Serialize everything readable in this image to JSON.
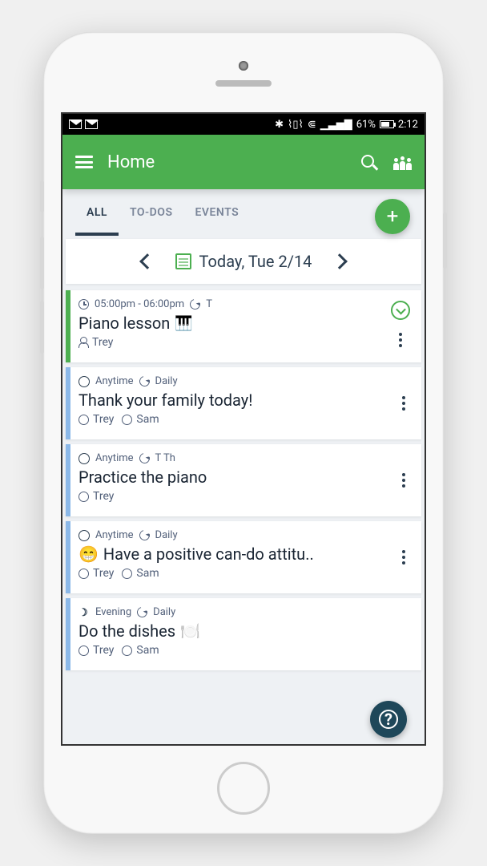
{
  "status": {
    "battery_pct": "61%",
    "time": "2:12"
  },
  "appbar": {
    "title": "Home"
  },
  "tabs": {
    "all": "ALL",
    "todos": "TO-DOS",
    "events": "EVENTS"
  },
  "date_nav": {
    "label": "Today, Tue 2/14"
  },
  "cards": [
    {
      "stripe": "green",
      "time": "05:00pm - 06:00pm",
      "repeat": "T",
      "title": "Piano lesson",
      "title_emoji": "🎹",
      "assignees": [
        {
          "name": "Trey",
          "type": "person"
        }
      ],
      "has_expand": true
    },
    {
      "stripe": "blue",
      "when": "Anytime",
      "repeat": "Daily",
      "title": "Thank your family today!",
      "title_emoji": "",
      "assignees": [
        {
          "name": "Trey",
          "type": "circle"
        },
        {
          "name": "Sam",
          "type": "circle"
        }
      ],
      "has_expand": false
    },
    {
      "stripe": "blue",
      "when": "Anytime",
      "repeat": "T Th",
      "title": "Practice the piano",
      "title_emoji": "",
      "assignees": [
        {
          "name": "Trey",
          "type": "circle"
        }
      ],
      "has_expand": false
    },
    {
      "stripe": "blue",
      "when": "Anytime",
      "repeat": "Daily",
      "pre_emoji": "😁",
      "title": "Have a positive can-do attitu..",
      "title_emoji": "",
      "assignees": [
        {
          "name": "Trey",
          "type": "circle"
        },
        {
          "name": "Sam",
          "type": "circle"
        }
      ],
      "has_expand": false
    },
    {
      "stripe": "blue",
      "when": "Evening",
      "when_icon": "moon",
      "repeat": "Daily",
      "title": "Do the dishes",
      "title_emoji": "🍽️",
      "assignees": [
        {
          "name": "Trey",
          "type": "circle"
        },
        {
          "name": "Sam",
          "type": "circle"
        }
      ],
      "has_expand": false
    }
  ]
}
